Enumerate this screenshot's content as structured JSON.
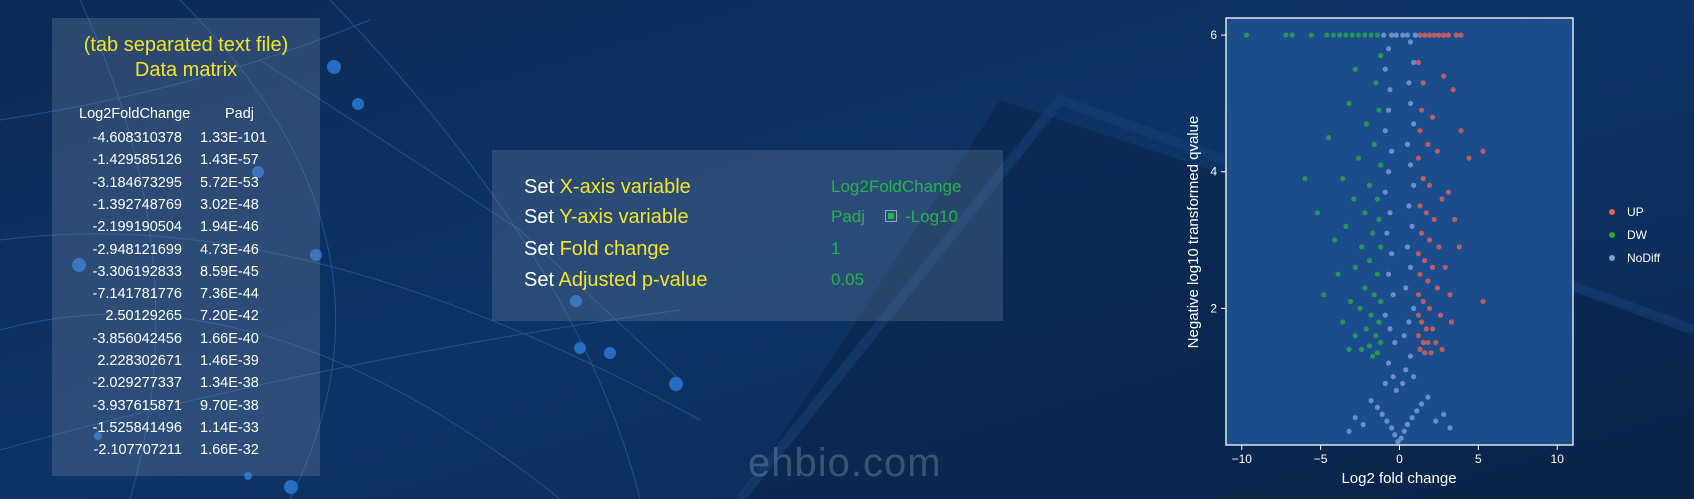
{
  "matrix": {
    "subtitle": "(tab separated text file)",
    "title": "Data matrix",
    "columns": [
      "Log2FoldChange",
      "Padj"
    ],
    "rows": [
      [
        "-4.608310378",
        "1.33E-101"
      ],
      [
        "-1.429585126",
        "1.43E-57"
      ],
      [
        "-3.184673295",
        "5.72E-53"
      ],
      [
        "-1.392748769",
        "3.02E-48"
      ],
      [
        "-2.199190504",
        "1.94E-46"
      ],
      [
        "-2.948121699",
        "4.73E-46"
      ],
      [
        "-3.306192833",
        "8.59E-45"
      ],
      [
        "-7.141781776",
        "7.36E-44"
      ],
      [
        "2.50129265",
        "7.20E-42"
      ],
      [
        "-3.856042456",
        "1.66E-40"
      ],
      [
        "2.228302671",
        "1.46E-39"
      ],
      [
        "-2.029277337",
        "1.34E-38"
      ],
      [
        "-3.937615871",
        "9.70E-38"
      ],
      [
        "-1.525841496",
        "1.14E-33"
      ],
      [
        "-2.107707211",
        "1.66E-32"
      ]
    ]
  },
  "settings": {
    "rows": [
      {
        "set": "Set",
        "label": "X-axis variable",
        "value": "Log2FoldChange"
      },
      {
        "set": "Set",
        "label": "Y-axis variable",
        "value": "Padj",
        "checkbox_label": "-Log10",
        "checked": true
      },
      {
        "set": "Set",
        "label": "Fold change",
        "value": "1"
      },
      {
        "set": "Set",
        "label": "Adjusted p-value",
        "value": "0.05"
      }
    ]
  },
  "watermark": "ehbio.com",
  "colors": {
    "up": "#e0635a",
    "dw": "#27a84a",
    "nodiff": "#7f9fdc",
    "highlight_yellow": "#f2e52a",
    "value_green": "#27b24a"
  },
  "chart_data": {
    "type": "scatter",
    "xlabel": "Log2 fold change",
    "ylabel": "Negative log10 transformed qvalue",
    "xlim": [
      -11,
      11
    ],
    "ylim": [
      0,
      6.25
    ],
    "x_ticks": [
      "-10",
      "-5",
      "0",
      "5",
      "10"
    ],
    "y_ticks": [
      "2",
      "4",
      "6"
    ],
    "grid": false,
    "legend_position": "right",
    "series": [
      {
        "name": "UP",
        "color": "#e0635a",
        "points": [
          [
            1.3,
            6
          ],
          [
            1.6,
            6
          ],
          [
            1.9,
            6
          ],
          [
            2.2,
            6
          ],
          [
            2.5,
            6
          ],
          [
            2.8,
            6
          ],
          [
            3.1,
            6
          ],
          [
            3.6,
            6
          ],
          [
            3.9,
            6
          ],
          [
            1.2,
            5.6
          ],
          [
            1.5,
            5.3
          ],
          [
            2.8,
            5.4
          ],
          [
            3.4,
            5.2
          ],
          [
            1.4,
            4.9
          ],
          [
            2.1,
            4.8
          ],
          [
            1.3,
            4.6
          ],
          [
            3.9,
            4.6
          ],
          [
            1.8,
            4.4
          ],
          [
            2.4,
            4.3
          ],
          [
            1.2,
            4.2
          ],
          [
            4.4,
            4.2
          ],
          [
            5.3,
            4.3
          ],
          [
            1.5,
            3.9
          ],
          [
            1.9,
            3.8
          ],
          [
            2.7,
            3.6
          ],
          [
            3.1,
            3.7
          ],
          [
            1.3,
            3.5
          ],
          [
            1.7,
            3.4
          ],
          [
            2.2,
            3.3
          ],
          [
            3.5,
            3.3
          ],
          [
            1.4,
            3.1
          ],
          [
            1.9,
            3.0
          ],
          [
            2.5,
            2.9
          ],
          [
            3.8,
            2.9
          ],
          [
            1.2,
            2.8
          ],
          [
            1.6,
            2.7
          ],
          [
            2.1,
            2.6
          ],
          [
            2.9,
            2.6
          ],
          [
            1.3,
            2.5
          ],
          [
            1.8,
            2.4
          ],
          [
            2.4,
            2.3
          ],
          [
            3.2,
            2.2
          ],
          [
            1.2,
            2.2
          ],
          [
            1.5,
            2.1
          ],
          [
            1.9,
            2.0
          ],
          [
            2.6,
            1.9
          ],
          [
            5.3,
            2.1
          ],
          [
            1.2,
            1.9
          ],
          [
            1.4,
            1.8
          ],
          [
            1.7,
            1.7
          ],
          [
            2.1,
            1.7
          ],
          [
            3.3,
            1.8
          ],
          [
            1.2,
            1.6
          ],
          [
            1.5,
            1.5
          ],
          [
            1.8,
            1.5
          ],
          [
            2.3,
            1.5
          ],
          [
            1.3,
            1.4
          ],
          [
            1.6,
            1.35
          ],
          [
            2.0,
            1.35
          ],
          [
            2.7,
            1.4
          ]
        ]
      },
      {
        "name": "DW",
        "color": "#27a84a",
        "points": [
          [
            -9.7,
            6
          ],
          [
            -7.2,
            6
          ],
          [
            -6.8,
            6
          ],
          [
            -5.6,
            6
          ],
          [
            -4.6,
            6
          ],
          [
            -4.2,
            6
          ],
          [
            -3.8,
            6
          ],
          [
            -3.4,
            6
          ],
          [
            -3.0,
            6
          ],
          [
            -2.6,
            6
          ],
          [
            -2.2,
            6
          ],
          [
            -1.8,
            6
          ],
          [
            -1.4,
            6
          ],
          [
            -1.2,
            5.7
          ],
          [
            -2.8,
            5.5
          ],
          [
            -1.5,
            5.3
          ],
          [
            -3.2,
            5.0
          ],
          [
            -1.3,
            4.9
          ],
          [
            -2.1,
            4.7
          ],
          [
            -4.5,
            4.5
          ],
          [
            -1.6,
            4.4
          ],
          [
            -2.6,
            4.2
          ],
          [
            -6.0,
            3.9
          ],
          [
            -1.2,
            4.1
          ],
          [
            -3.6,
            3.9
          ],
          [
            -1.9,
            3.8
          ],
          [
            -2.9,
            3.6
          ],
          [
            -1.4,
            3.6
          ],
          [
            -5.2,
            3.4
          ],
          [
            -2.2,
            3.4
          ],
          [
            -1.3,
            3.3
          ],
          [
            -3.4,
            3.2
          ],
          [
            -1.7,
            3.1
          ],
          [
            -4.1,
            3.0
          ],
          [
            -2.4,
            2.9
          ],
          [
            -1.2,
            2.9
          ],
          [
            -1.9,
            2.7
          ],
          [
            -2.8,
            2.6
          ],
          [
            -3.9,
            2.5
          ],
          [
            -1.4,
            2.5
          ],
          [
            -2.2,
            2.3
          ],
          [
            -1.6,
            2.2
          ],
          [
            -4.8,
            2.2
          ],
          [
            -3.1,
            2.1
          ],
          [
            -1.2,
            2.1
          ],
          [
            -2.5,
            2.0
          ],
          [
            -1.8,
            1.9
          ],
          [
            -1.3,
            1.8
          ],
          [
            -3.6,
            1.8
          ],
          [
            -2.1,
            1.7
          ],
          [
            -1.5,
            1.6
          ],
          [
            -2.8,
            1.6
          ],
          [
            -1.2,
            1.5
          ],
          [
            -1.9,
            1.45
          ],
          [
            -2.4,
            1.4
          ],
          [
            -1.4,
            1.35
          ],
          [
            -3.2,
            1.4
          ],
          [
            -1.7,
            1.3
          ]
        ]
      },
      {
        "name": "NoDiff",
        "color": "#7f9fdc",
        "points": [
          [
            -0.1,
            0.05
          ],
          [
            0.1,
            0.1
          ],
          [
            -0.3,
            0.15
          ],
          [
            0.3,
            0.2
          ],
          [
            -0.5,
            0.25
          ],
          [
            0.5,
            0.3
          ],
          [
            -0.8,
            0.35
          ],
          [
            0.8,
            0.4
          ],
          [
            -1.1,
            0.45
          ],
          [
            1.1,
            0.5
          ],
          [
            -1.4,
            0.55
          ],
          [
            1.4,
            0.6
          ],
          [
            -1.8,
            0.65
          ],
          [
            1.8,
            0.7
          ],
          [
            -2.3,
            0.3
          ],
          [
            2.3,
            0.35
          ],
          [
            -2.8,
            0.4
          ],
          [
            2.8,
            0.45
          ],
          [
            -3.2,
            0.2
          ],
          [
            3.2,
            0.25
          ],
          [
            -0.2,
            0.8
          ],
          [
            0.2,
            0.9
          ],
          [
            -0.4,
            1.0
          ],
          [
            0.4,
            1.1
          ],
          [
            -0.7,
            1.2
          ],
          [
            0.7,
            1.3
          ],
          [
            -0.9,
            0.9
          ],
          [
            0.9,
            1.0
          ],
          [
            -0.3,
            1.5
          ],
          [
            0.3,
            1.6
          ],
          [
            -0.6,
            1.7
          ],
          [
            0.6,
            1.8
          ],
          [
            -0.9,
            1.9
          ],
          [
            0.9,
            2.0
          ],
          [
            -0.4,
            2.2
          ],
          [
            0.4,
            2.3
          ],
          [
            -0.7,
            2.5
          ],
          [
            0.7,
            2.6
          ],
          [
            -0.5,
            2.8
          ],
          [
            0.5,
            2.9
          ],
          [
            -0.8,
            3.1
          ],
          [
            0.8,
            3.2
          ],
          [
            -0.6,
            3.4
          ],
          [
            0.6,
            3.5
          ],
          [
            -0.9,
            3.7
          ],
          [
            0.9,
            3.8
          ],
          [
            -0.7,
            4.0
          ],
          [
            0.7,
            4.1
          ],
          [
            -0.5,
            4.3
          ],
          [
            0.5,
            4.4
          ],
          [
            -0.9,
            4.6
          ],
          [
            0.9,
            4.7
          ],
          [
            -0.7,
            4.9
          ],
          [
            0.7,
            5.0
          ],
          [
            -0.6,
            5.2
          ],
          [
            0.6,
            5.3
          ],
          [
            -0.9,
            5.5
          ],
          [
            0.9,
            5.6
          ],
          [
            -0.7,
            5.8
          ],
          [
            0.7,
            5.9
          ],
          [
            -0.5,
            6
          ],
          [
            -0.2,
            6
          ],
          [
            0.2,
            6
          ],
          [
            0.5,
            6
          ],
          [
            -1.0,
            6
          ],
          [
            1.0,
            6
          ]
        ]
      }
    ]
  }
}
